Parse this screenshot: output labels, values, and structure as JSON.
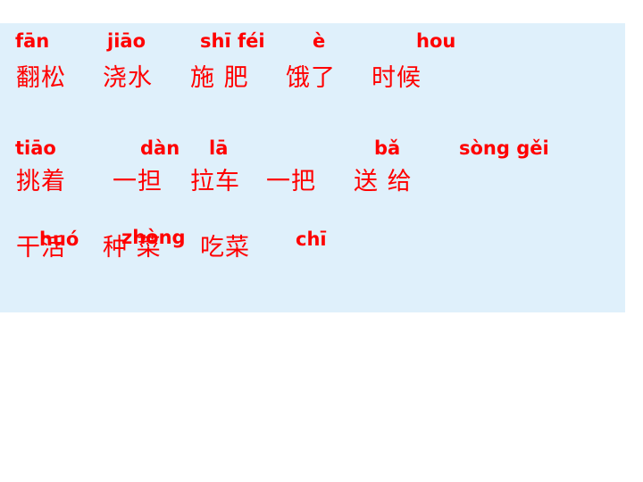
{
  "rows": [
    {
      "pinyin": [
        "fān",
        "jiāo",
        "shī féi",
        "è",
        "hou"
      ],
      "chinese": [
        "翻松",
        "浇水",
        "施 肥",
        "饿了",
        "时候"
      ]
    },
    {
      "pinyin": [
        "tiāo",
        "dàn",
        "lā",
        "bǎ",
        "sòng gěi"
      ],
      "chinese": [
        "挑着",
        "一担",
        "拉车",
        "一把",
        "送 给"
      ]
    },
    {
      "pinyin": [
        "huó",
        "zhòng",
        "chī"
      ],
      "chinese": [
        "干活",
        "种 菜",
        "吃菜"
      ]
    }
  ],
  "colors": {
    "text": "#ff0000",
    "panel": "#dff0fb",
    "background": "#ffffff"
  }
}
